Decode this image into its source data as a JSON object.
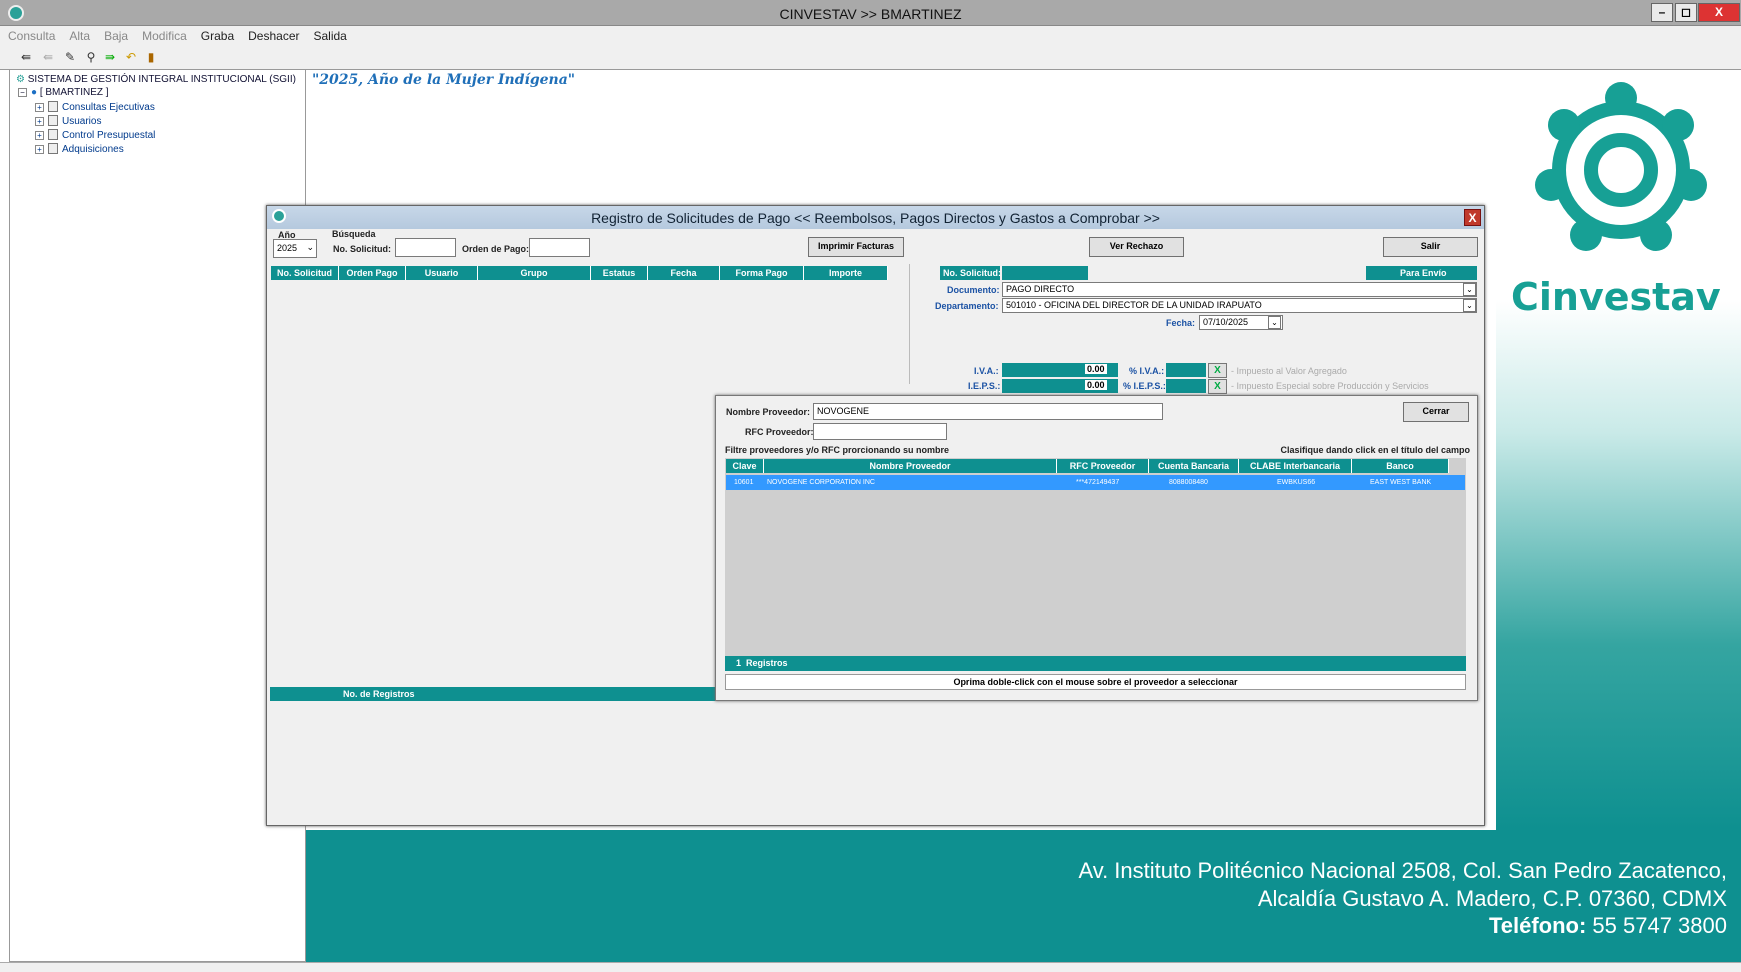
{
  "window": {
    "title": "CINVESTAV >> BMARTINEZ",
    "min": "–",
    "max": "◻",
    "close": "X"
  },
  "menu": [
    {
      "label": "Consulta",
      "dim": true
    },
    {
      "label": "Alta",
      "dim": true
    },
    {
      "label": "Baja",
      "dim": true
    },
    {
      "label": "Modifica",
      "dim": true
    },
    {
      "label": "Graba",
      "dim": false
    },
    {
      "label": "Deshacer",
      "dim": false
    },
    {
      "label": "Salida",
      "dim": false
    }
  ],
  "toolbar_icons": [
    "add-record-icon",
    "remove-record-icon",
    "edit-icon",
    "search-icon",
    "save-icon",
    "undo-icon",
    "exit-icon"
  ],
  "tree": {
    "root": "SISTEMA DE GESTIÓN INTEGRAL INSTITUCIONAL (SGII)",
    "user": "[   BMARTINEZ   ]",
    "items": [
      "Consultas Ejecutivas",
      "Usuarios",
      "Control Presupuestal",
      "Adquisiciones"
    ]
  },
  "motto": "\"2025, Año de la Mujer Indígena\"",
  "brand": "Cinvestav",
  "address": {
    "line1": "Av. Instituto Politécnico Nacional 2508, Col. San Pedro Zacatenco,",
    "line2": "Alcaldía Gustavo A. Madero, C.P. 07360, CDMX",
    "phone_label": "Teléfono:",
    "phone": "55 5747 3800"
  },
  "dialog": {
    "title": "Registro de Solicitudes de Pago << Reembolsos, Pagos Directos y Gastos a Comprobar >>",
    "close": "X",
    "anio_label": "Año",
    "anio_value": "2025",
    "busqueda_label": "Búsqueda",
    "no_solicitud_label": "No. Solicitud:",
    "orden_pago_label": "Orden de Pago:",
    "imprimir_label": "Imprimir Facturas",
    "ver_rechazo_label": "Ver Rechazo",
    "salir_label": "Salir",
    "list_headers": [
      "No. Solicitud",
      "Orden Pago",
      "Usuario",
      "Grupo",
      "Estatus",
      "Fecha",
      "Forma Pago",
      "Importe"
    ],
    "no_registros_label": "No. de Registros",
    "detail": {
      "no_solicitud_label": "No. Solicitud:",
      "para_envio": "Para Envío",
      "documento_label": "Documento:",
      "documento_value": "PAGO DIRECTO",
      "departamento_label": "Departamento:",
      "departamento_value": "501010 - OFICINA DEL DIRECTOR DE LA UNIDAD IRAPUATO",
      "fecha_label": "Fecha:",
      "fecha_value": "07/10/2025",
      "iva_label": "I.V.A.:",
      "iva_value": "0.00",
      "pct_iva_label": "% I.V.A.:",
      "iva_desc": "- Impuesto al Valor Agregado",
      "ieps_label": "I.E.P.S.:",
      "ieps_value": "0.00",
      "pct_ieps_label": "% I.E.P.S.:",
      "ieps_desc": "- Impuesto Especial sobre Producción y Servicios",
      "x": "X"
    }
  },
  "lookup": {
    "nombre_label": "Nombre Proveedor:",
    "nombre_value": "NOVOGENE",
    "rfc_label": "RFC Proveedor:",
    "rfc_value": "",
    "cerrar_label": "Cerrar",
    "filter_hint": "Filtre proveedores y/o RFC prorcionando su nombre",
    "sort_hint": "Clasifique dando click en el título del campo",
    "headers": [
      "Clave",
      "Nombre Proveedor",
      "RFC Proveedor",
      "Cuenta Bancaria",
      "CLABE Interbancaria",
      "Banco"
    ],
    "rows": [
      {
        "clave": "10601",
        "nombre": "NOVOGENE CORPORATION INC",
        "rfc": "***472149437",
        "cuenta": "8088008480",
        "clabe": "EWBKUS66",
        "banco": "EAST WEST BANK"
      }
    ],
    "count": "1",
    "count_label": "Registros",
    "footer_hint": "Oprima doble-click con el mouse sobre el proveedor a seleccionar"
  }
}
